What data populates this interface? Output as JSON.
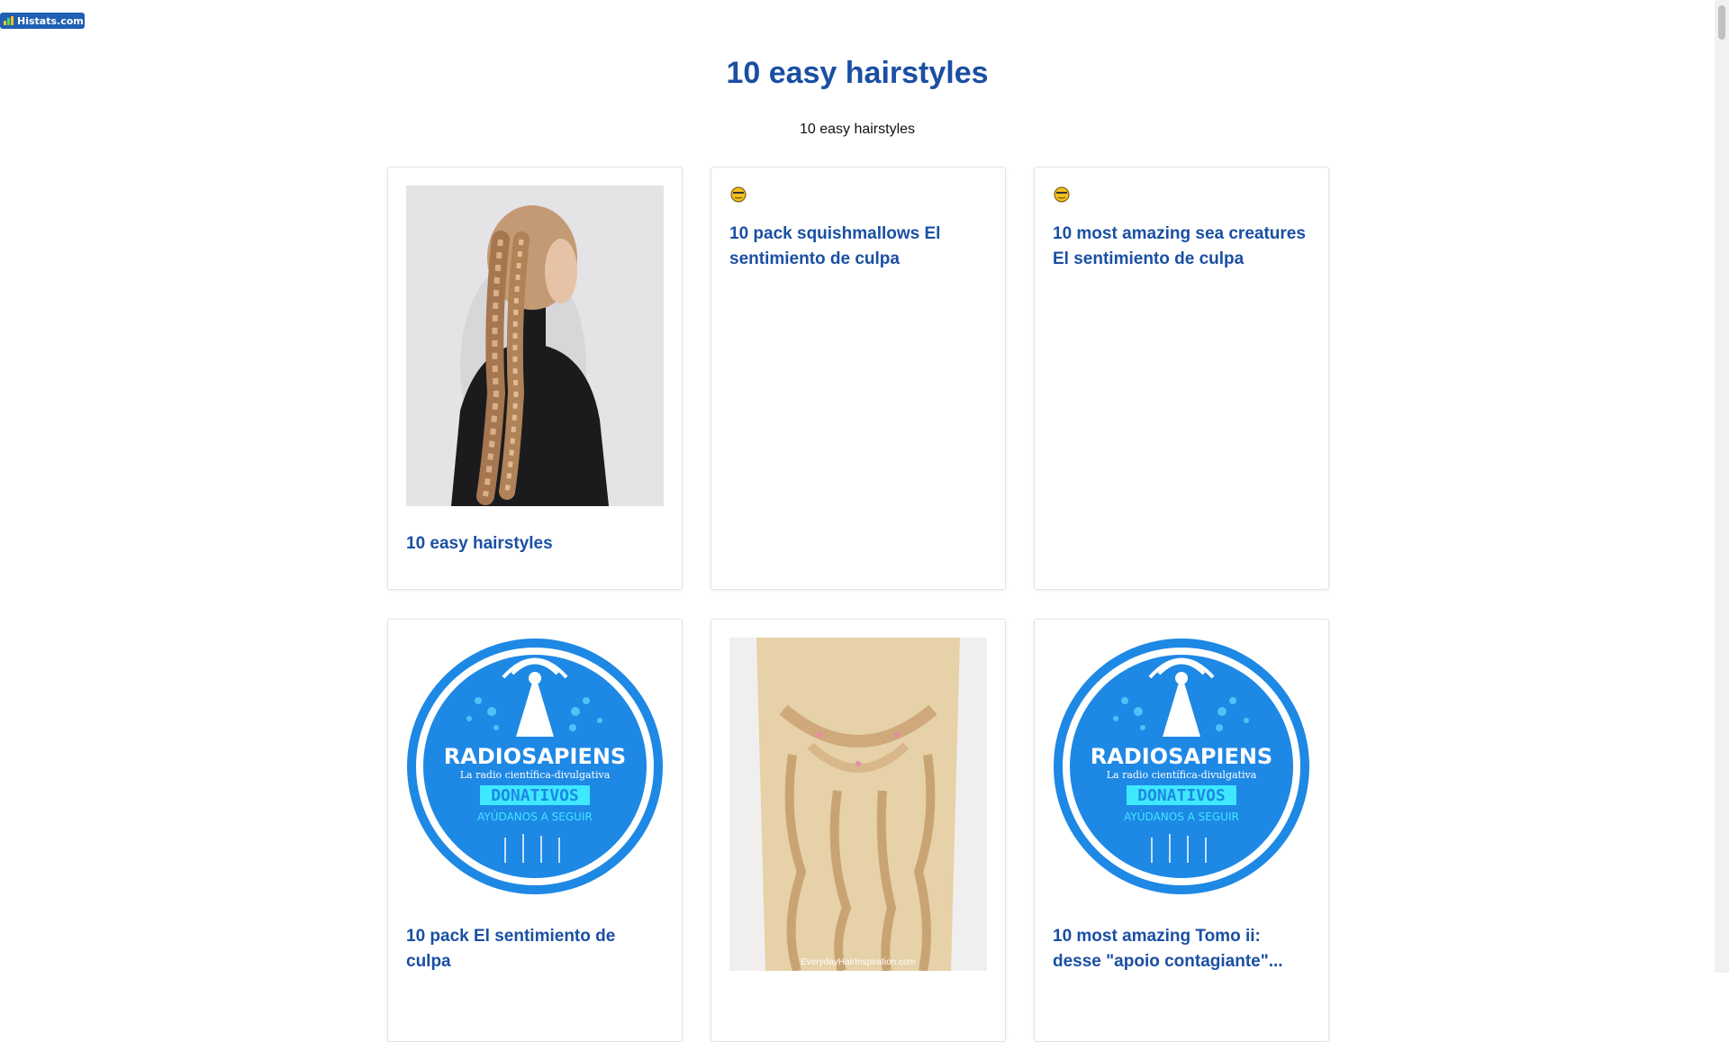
{
  "badge": {
    "label": "Histats.com"
  },
  "header": {
    "title": "10 easy hairstyles",
    "subtitle": "10 easy hairstyles"
  },
  "cards": [
    {
      "title": "10 easy hairstyles",
      "image": "braided-hair-photo"
    },
    {
      "title": "10 pack squishmallows El sentimiento de culpa",
      "image": "emoji-face-icon"
    },
    {
      "title": "10 most amazing sea creatures El sentimiento de culpa",
      "image": "emoji-face-icon"
    },
    {
      "title": "10 pack El sentimiento de culpa",
      "image": "radiosapiens-logo"
    },
    {
      "title": "",
      "image": "blonde-hair-photo",
      "watermark": "EverydayHairInspiration.com"
    },
    {
      "title": "10 most amazing Tomo ii: desse \"apoio contagiante\"...",
      "image": "radiosapiens-logo"
    }
  ],
  "logo": {
    "name": "RADIOSAPIENS",
    "tagline": "La radio científica-divulgativa",
    "banner": "DONATIVOS",
    "cta": "AYÚDANOS A SEGUIR"
  },
  "colors": {
    "title_blue": "#1a4fa3",
    "logo_blue": "#1e88e5",
    "banner_cyan": "#3ee8ff"
  }
}
